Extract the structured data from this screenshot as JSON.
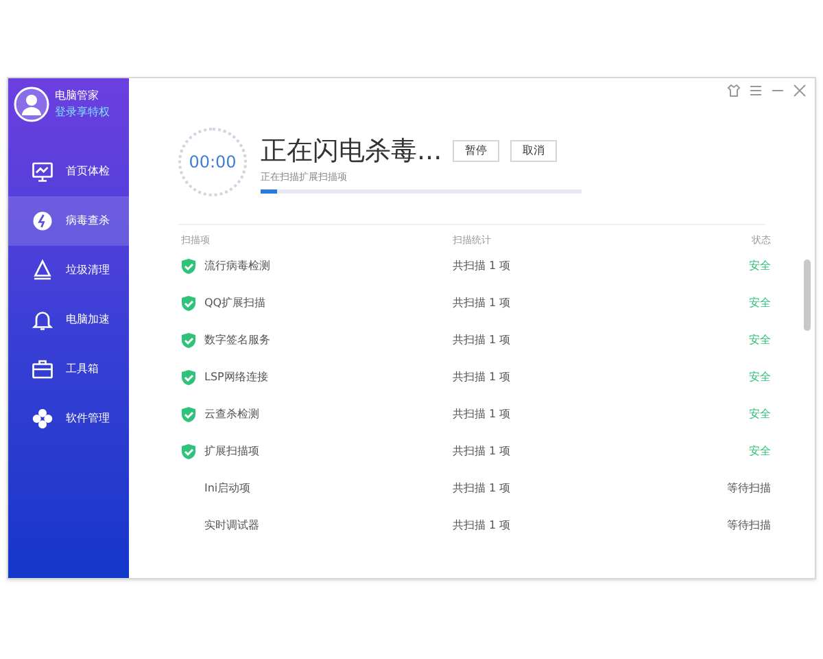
{
  "sidebar": {
    "user": {
      "name": "电脑管家",
      "login": "登录享特权"
    },
    "items": [
      {
        "label": "首页体检",
        "selected": false
      },
      {
        "label": "病毒查杀",
        "selected": true
      },
      {
        "label": "垃圾清理",
        "selected": false
      },
      {
        "label": "电脑加速",
        "selected": false
      },
      {
        "label": "工具箱",
        "selected": false
      },
      {
        "label": "软件管理",
        "selected": false
      }
    ]
  },
  "scan": {
    "timer": "00:00",
    "title": "正在闪电杀毒...",
    "buttons": [
      "暂停",
      "取消"
    ],
    "subtitle": "正在扫描扩展扫描项",
    "level": 0.05
  },
  "table": {
    "columns": [
      "扫描项",
      "扫描统计",
      "状态"
    ],
    "rows": [
      {
        "item": "流行病毒检测",
        "count": "共扫描 1 项",
        "status": "安全",
        "safe": true
      },
      {
        "item": "QQ扩展扫描",
        "count": "共扫描 1 项",
        "status": "安全",
        "safe": true
      },
      {
        "item": "数字签名服务",
        "count": "共扫描 1 项",
        "status": "安全",
        "safe": true
      },
      {
        "item": "LSP网络连接",
        "count": "共扫描 1 项",
        "status": "安全",
        "safe": true
      },
      {
        "item": "云查杀检测",
        "count": "共扫描 1 项",
        "status": "安全",
        "safe": true
      },
      {
        "item": "扩展扫描项",
        "count": "共扫描 1 项",
        "status": "安全",
        "safe": true
      },
      {
        "item": "Ini启动项",
        "count": "共扫描 1 项",
        "status": "等待扫描",
        "safe": false
      },
      {
        "item": "实时调试器",
        "count": "共扫描 1 项",
        "status": "等待扫描",
        "safe": false
      }
    ]
  }
}
